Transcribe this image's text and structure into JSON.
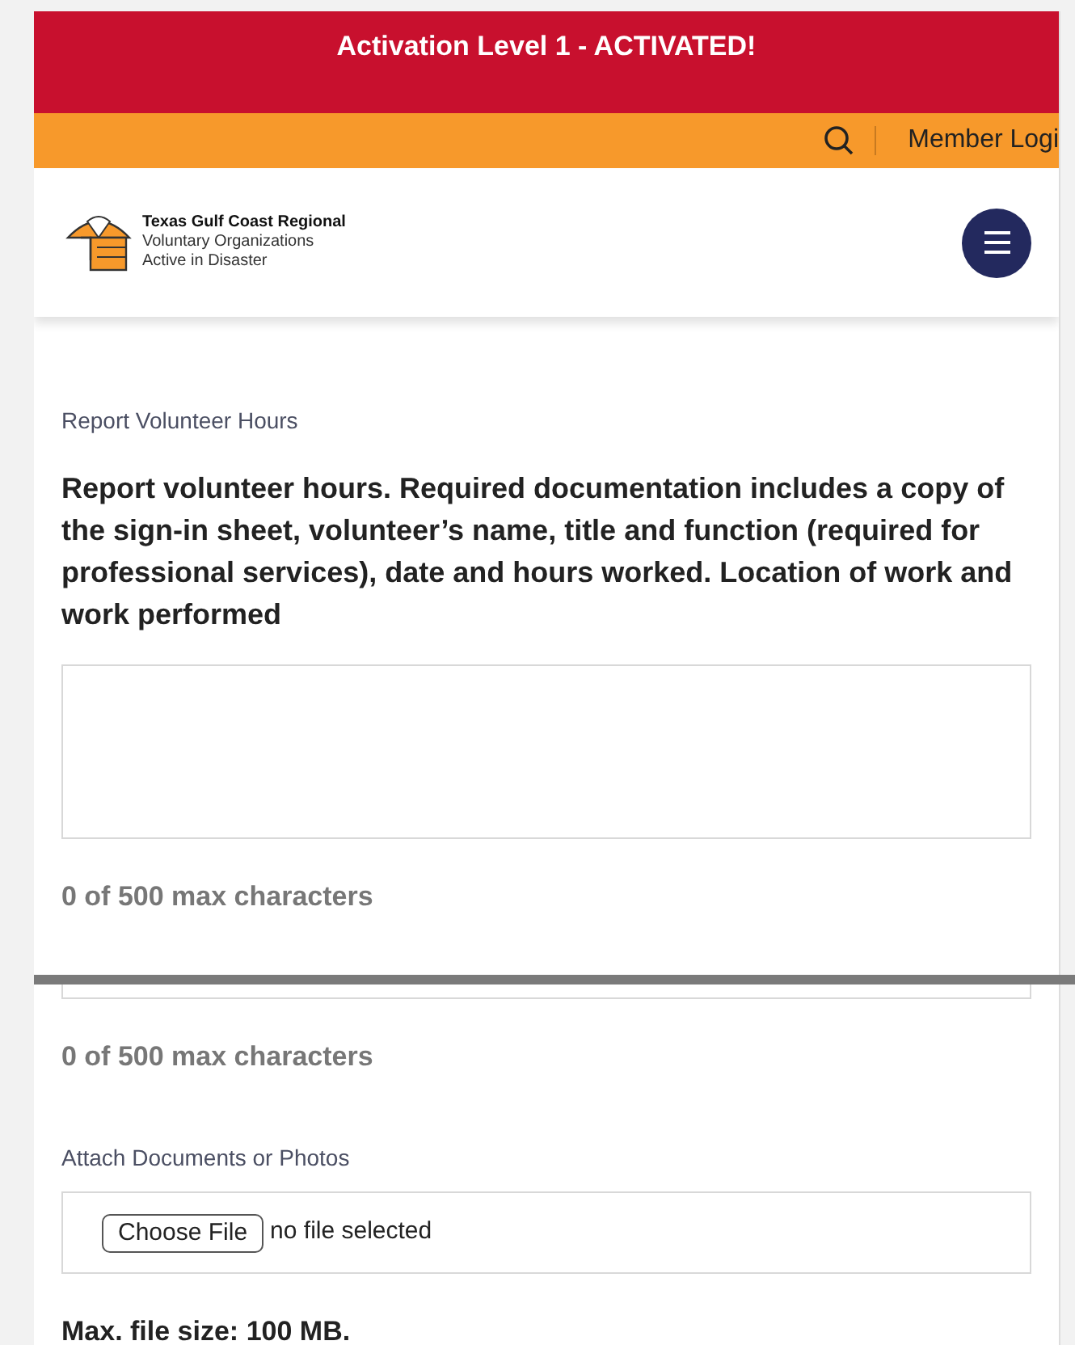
{
  "alert_bar": {
    "text": "Activation Level 1 - ACTIVATED!"
  },
  "top_bar": {
    "member_login": "Member Logi"
  },
  "header": {
    "logo_lines": [
      "Texas Gulf Coast Regional",
      "Voluntary Organizations",
      "Active in Disaster"
    ]
  },
  "first_section": {
    "field_label": "Report Volunteer Hours",
    "question": "Report volunteer hours. Required documentation includes a copy of the sign-in sheet, volunteer’s name, title and function (required for professional services), date and hours worked. Location of work and work performed",
    "counter": "0 of 500 max characters"
  },
  "second_section": {
    "counter": "0 of 500 max characters",
    "field_label": "Attach Documents or Photos",
    "file_button": "Choose File",
    "file_status": "no file selected",
    "note": "Max. file size: 100 MB."
  }
}
